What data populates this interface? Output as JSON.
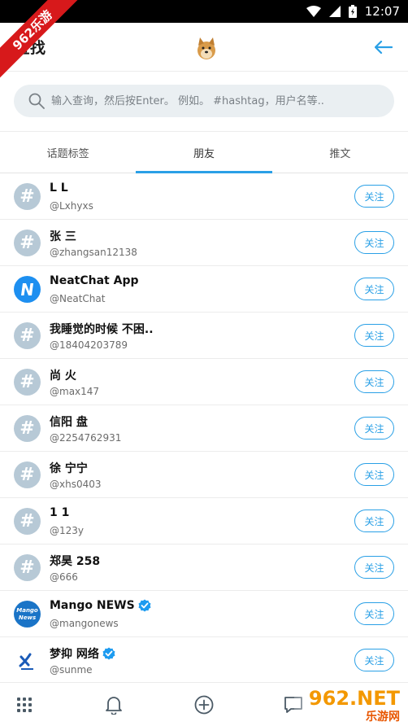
{
  "status_bar": {
    "time": "12:07",
    "corner_badge": "962乐游"
  },
  "header": {
    "title": "查找",
    "back_icon": "arrow-left-icon",
    "avatar_icon": "doge-avatar-icon"
  },
  "search": {
    "placeholder": "输入查询，然后按Enter。 例如。 #hashtag，用户名等.."
  },
  "tabs": [
    {
      "label": "话题标签",
      "active": false
    },
    {
      "label": "朋友",
      "active": true
    },
    {
      "label": "推文",
      "active": false
    }
  ],
  "users": [
    {
      "name": "L L",
      "handle": "@Lxhyxs",
      "avatar": "hash",
      "verified": false,
      "follow": "关注"
    },
    {
      "name": "张 三",
      "handle": "@zhangsan12138",
      "avatar": "hash",
      "verified": false,
      "follow": "关注"
    },
    {
      "name": "NeatChat App",
      "handle": "@NeatChat",
      "avatar": "neatchat",
      "verified": false,
      "follow": "关注"
    },
    {
      "name": "我睡觉的时候 不困..",
      "handle": "@18404203789",
      "avatar": "hash",
      "verified": false,
      "follow": "关注"
    },
    {
      "name": "尚 火",
      "handle": "@max147",
      "avatar": "hash",
      "verified": false,
      "follow": "关注"
    },
    {
      "name": "信阳 盘",
      "handle": "@2254762931",
      "avatar": "hash",
      "verified": false,
      "follow": "关注"
    },
    {
      "name": "徐 宁宁",
      "handle": "@xhs0403",
      "avatar": "hash",
      "verified": false,
      "follow": "关注"
    },
    {
      "name": "1 1",
      "handle": "@123y",
      "avatar": "hash",
      "verified": false,
      "follow": "关注"
    },
    {
      "name": "郑昊 258",
      "handle": "@666",
      "avatar": "hash",
      "verified": false,
      "follow": "关注"
    },
    {
      "name": "Mango NEWS",
      "handle": "@mangonews",
      "avatar": "mango",
      "verified": true,
      "follow": "关注"
    },
    {
      "name": "梦抑 网络",
      "handle": "@sunme",
      "avatar": "sunme",
      "verified": true,
      "follow": "关注"
    }
  ],
  "avatar_text": {
    "hash": "#",
    "neatchat": "N",
    "mango_line1": "Mango",
    "mango_line2": "News"
  },
  "bottom_nav": [
    "grid-icon",
    "bell-icon",
    "plus-circle-icon",
    "chat-icon"
  ],
  "watermark": {
    "main": "962.NET",
    "sub": "乐游网"
  },
  "colors": {
    "accent": "#2aa0e6",
    "hash_avatar": "#b7c9d6",
    "verified": "#1d9bf0"
  }
}
